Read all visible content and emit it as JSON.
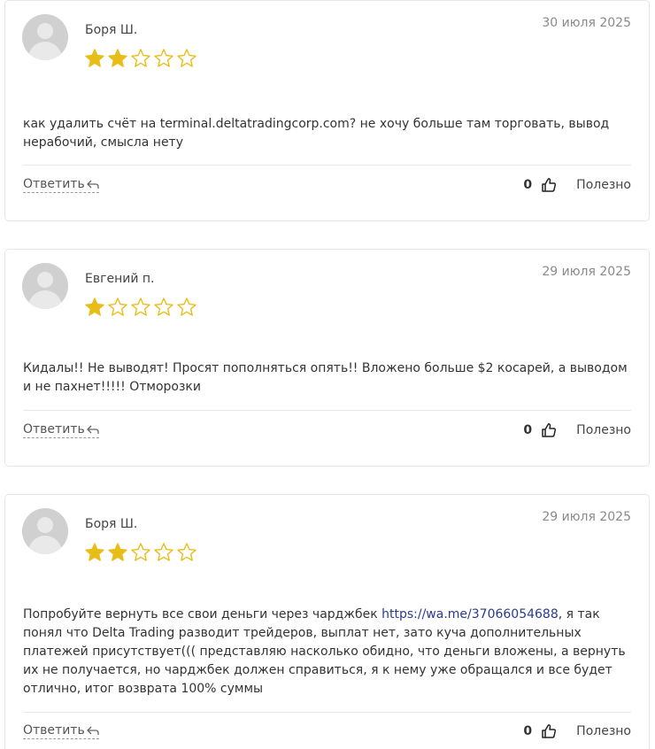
{
  "reviews": [
    {
      "author": "Боря Ш.",
      "date": "30 июля 2025",
      "rating": 2,
      "text": "как удалить счёт на terminal.deltatradingcorp.com? не хочу больше там торговать, вывод нерабочий, смысла нету",
      "reply_label": "Ответить",
      "helpful_count": "0",
      "helpful_label": "Полезно"
    },
    {
      "author": "Евгений п.",
      "date": "29 июля 2025",
      "rating": 1,
      "text": "Кидалы!! Не выводят! Просят пополняться опять!! Вложено больше $2 косарей, а выводом и не пахнет!!!!! Отморозки",
      "reply_label": "Ответить",
      "helpful_count": "0",
      "helpful_label": "Полезно"
    },
    {
      "author": "Боря Ш.",
      "date": "29 июля 2025",
      "rating": 2,
      "text_before_link": "Попробуйте вернуть все свои деньги через чарджбек ",
      "link_text": "https://wa.me/37066054688",
      "text_after_link": ", я так понял что Delta Trading разводит трейдеров, выплат нет, зато куча дополнительных платежей присутствует((( представляю насколько обидно, что деньги вложены, а вернуть их не получается, но чарджбек должен справиться, я к нему уже обращался и все будет отлично, итог возврата 100% суммы",
      "reply_label": "Ответить",
      "helpful_count": "0",
      "helpful_label": "Полезно"
    }
  ],
  "colors": {
    "star_filled": "#e9bd18",
    "star_empty_stroke": "#e9bd18",
    "link": "#2a3a8c",
    "border": "#e6e6e6"
  },
  "icons": {
    "reply": "reply-arrow-icon",
    "like": "thumbs-up-icon",
    "avatar": "user-avatar-icon"
  }
}
